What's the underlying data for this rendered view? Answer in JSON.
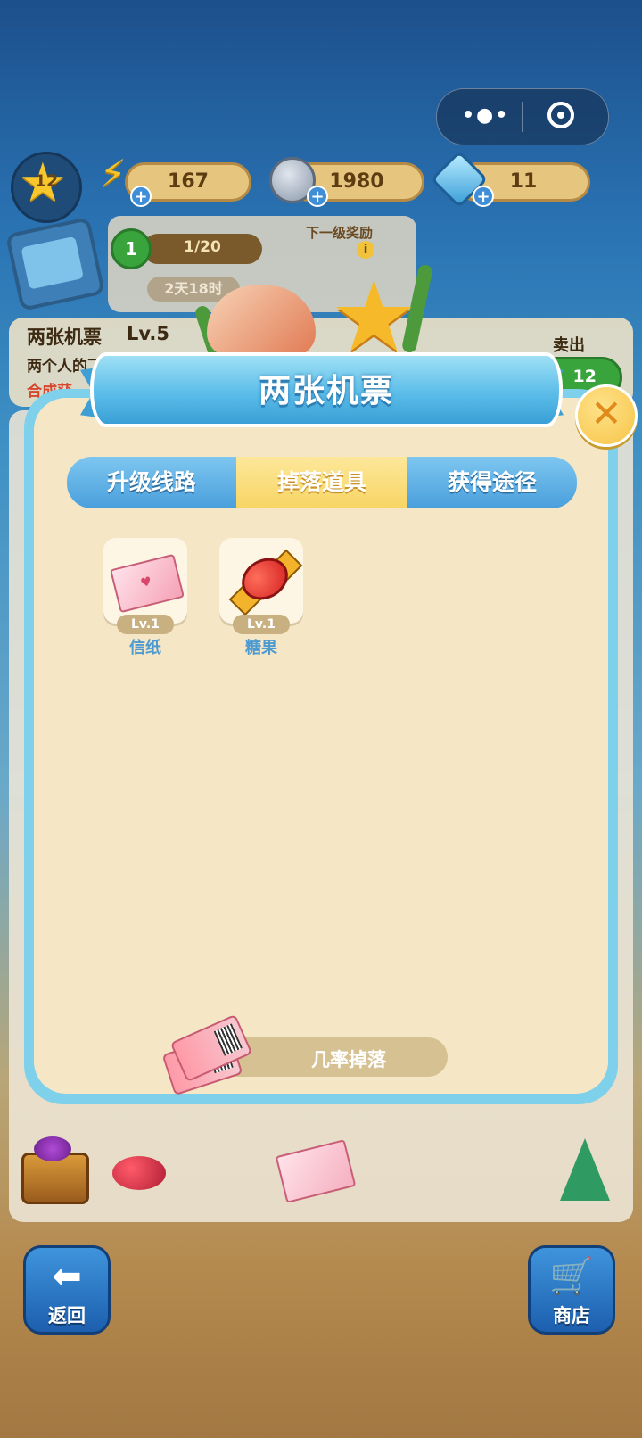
{
  "header": {
    "player_level": "12",
    "energy": "167",
    "coins": "1980",
    "gems": "11"
  },
  "rank": {
    "medal_level": "1",
    "progress": "1/20",
    "time_left": "2天18时",
    "next_reward_label": "下一级奖励"
  },
  "item": {
    "name": "两张机票",
    "level": "Lv.5",
    "description": "两个人的飞行",
    "subtext": "合成获",
    "sell_label": "卖出",
    "sell_price": "12"
  },
  "modal": {
    "title": "两张机票",
    "close_symbol": "✕",
    "tabs": [
      {
        "label": "升级线路",
        "active": false
      },
      {
        "label": "掉落道具",
        "active": true
      },
      {
        "label": "获得途径",
        "active": false
      }
    ],
    "drops": [
      {
        "name": "信纸",
        "level": "Lv.1",
        "icon": "letter-paper-icon"
      },
      {
        "name": "糖果",
        "level": "Lv.1",
        "icon": "candy-icon"
      }
    ],
    "drop_rate_label": "几率掉落"
  },
  "bottom": {
    "back_label": "返回",
    "shop_label": "商店"
  },
  "colors": {
    "modal_border": "#7fd0ea",
    "modal_bg": "#f5e6c6",
    "tab_blue": "#4a9fdc",
    "tab_active": "#f7d564",
    "drop_name": "#4d9ad1"
  }
}
